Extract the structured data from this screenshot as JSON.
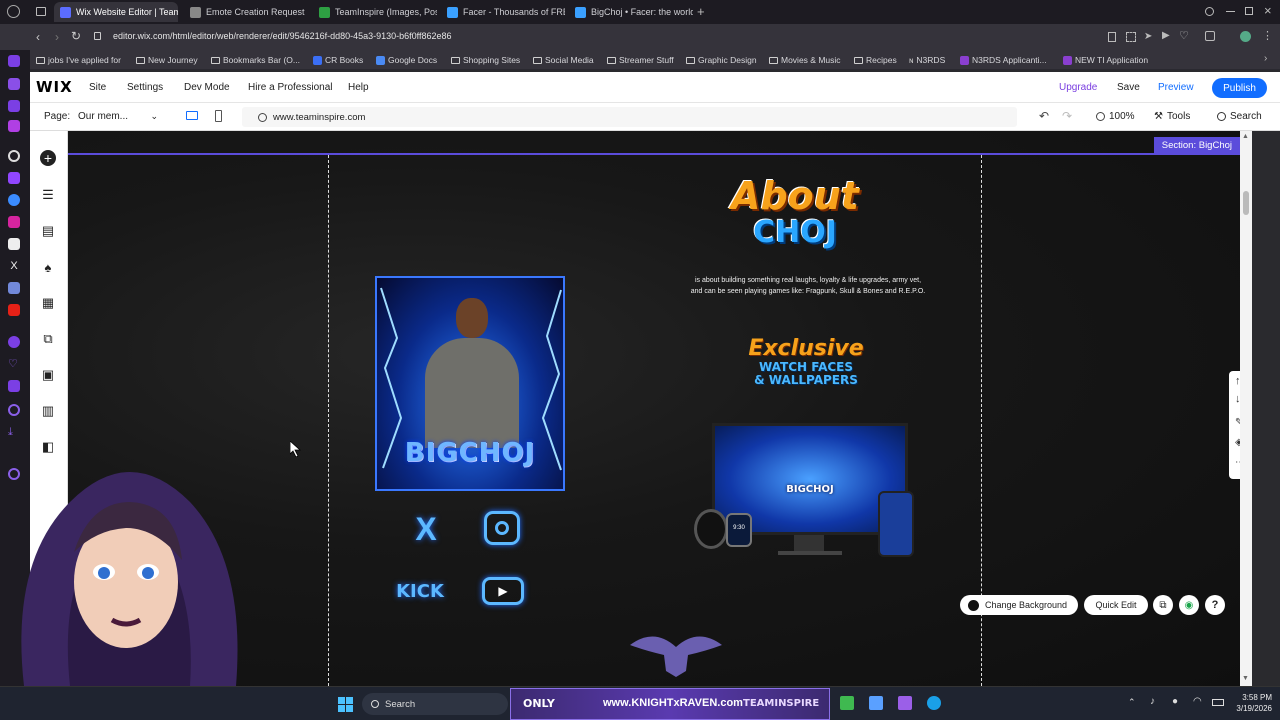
{
  "browser": {
    "tabs": [
      {
        "label": "Wix Website Editor | Team",
        "color": "#5b6cff",
        "active": true
      },
      {
        "label": "Emote Creation Request",
        "color": "#777777",
        "active": false
      },
      {
        "label": "TeamInspire (Images, Pos",
        "color": "#2ea043",
        "active": false
      },
      {
        "label": "Facer - Thousands of FRE",
        "color": "#3aa0ff",
        "active": false
      },
      {
        "label": "BigChoj • Facer: the world",
        "color": "#3aa0ff",
        "active": false
      }
    ],
    "url": "editor.wix.com/html/editor/web/renderer/edit/9546216f-dd80-45a3-9130-b6f0ff862e86",
    "bookmarks": [
      "jobs I've applied for",
      "New Journey",
      "Bookmarks Bar (O...",
      "CR Books",
      "Google Docs",
      "Shopping Sites",
      "Social Media",
      "Streamer Stuff",
      "Graphic Design",
      "Movies & Music",
      "Recipes",
      "N3RDS",
      "N3RDS Applicanti...",
      "NEW TI Application"
    ]
  },
  "wix": {
    "logo": "WIX",
    "menu": [
      "Site",
      "Settings",
      "Dev Mode",
      "Hire a Professional",
      "Help"
    ],
    "upgrade": "Upgrade",
    "save": "Save",
    "preview": "Preview",
    "publish": "Publish",
    "page_label": "Page:",
    "page_value": "Our mem...",
    "domain": "www.teaminspire.com",
    "zoom": "100%",
    "tools": "Tools",
    "search": "Search",
    "section_badge": "Section: BigChoj",
    "change_background": "Change Background",
    "quick_edit": "Quick Edit"
  },
  "content": {
    "about_title_1": "About",
    "about_title_2": "CHOJ",
    "about_text_1": "is about building something real  laughs, loyalty & life upgrades, army vet,",
    "about_text_2": "and can be seen playing games like: Fragpunk, Skull & Bones and R.E.P.O.",
    "exclusive_1": "Exclusive",
    "exclusive_2": "WATCH FACES",
    "exclusive_3": "& WALLPAPERS",
    "profile_name": "BIGCHOJ",
    "kick_label": "KICK",
    "device_label": "BIGCHOJ",
    "watch_time": "9:30"
  },
  "taskbar": {
    "search": "Search",
    "only_label": "ONLY",
    "brand_1": "www.KNIGHTxRAVEN.com",
    "brand_2": "TEAMINSPIRE",
    "time": "3:58 PM",
    "date": "3/19/2026"
  },
  "colors": {
    "accent": "#5b4cdb",
    "publish": "#116dff",
    "link_blue": "#116dff",
    "canvas_bg": "#141414"
  }
}
